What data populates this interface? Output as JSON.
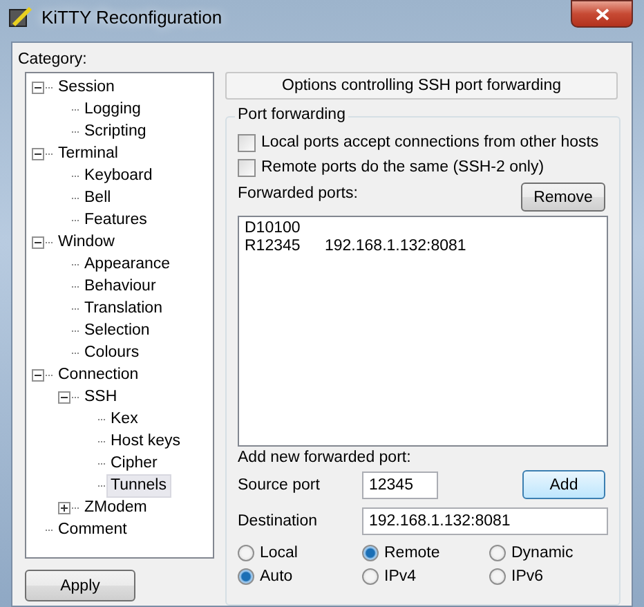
{
  "window": {
    "title": "KiTTY Reconfiguration"
  },
  "category_label": "Category:",
  "tree": {
    "items": [
      {
        "label": "Session",
        "expanded": true,
        "selected": false,
        "children": [
          {
            "label": "Logging",
            "selected": false
          },
          {
            "label": "Scripting",
            "selected": false
          }
        ]
      },
      {
        "label": "Terminal",
        "expanded": true,
        "selected": false,
        "children": [
          {
            "label": "Keyboard",
            "selected": false
          },
          {
            "label": "Bell",
            "selected": false
          },
          {
            "label": "Features",
            "selected": false
          }
        ]
      },
      {
        "label": "Window",
        "expanded": true,
        "selected": false,
        "children": [
          {
            "label": "Appearance",
            "selected": false
          },
          {
            "label": "Behaviour",
            "selected": false
          },
          {
            "label": "Translation",
            "selected": false
          },
          {
            "label": "Selection",
            "selected": false
          },
          {
            "label": "Colours",
            "selected": false
          }
        ]
      },
      {
        "label": "Connection",
        "expanded": true,
        "selected": false,
        "children": [
          {
            "label": "SSH",
            "expanded": true,
            "selected": false,
            "children": [
              {
                "label": "Kex",
                "selected": false
              },
              {
                "label": "Host keys",
                "selected": false
              },
              {
                "label": "Cipher",
                "selected": false
              },
              {
                "label": "Tunnels",
                "selected": true
              }
            ]
          },
          {
            "label": "ZModem",
            "expanded": false,
            "selected": false
          }
        ]
      },
      {
        "label": "Comment",
        "selected": false
      }
    ]
  },
  "apply_button": "Apply",
  "panel_title": "Options controlling SSH port forwarding",
  "port_forwarding": {
    "title": "Port forwarding",
    "checkboxes": [
      {
        "label": "Local ports accept connections from other hosts",
        "checked": false
      },
      {
        "label": "Remote ports do the same (SSH-2 only)",
        "checked": false
      }
    ],
    "forwarded_ports_label": "Forwarded ports:",
    "remove_button": "Remove",
    "forwarded_ports": [
      {
        "port": "D10100"
      },
      {
        "port": "R12345",
        "destination": "192.168.1.132:8081"
      }
    ]
  },
  "add_new": {
    "label": "Add new forwarded port:",
    "source_port": {
      "label": "Source port",
      "value": "12345"
    },
    "add_button": "Add",
    "destination": {
      "label": "Destination",
      "value": "192.168.1.132:8081"
    },
    "radio_rows": [
      {
        "options": [
          {
            "label": "Local",
            "selected": false
          },
          {
            "label": "Remote",
            "selected": true
          },
          {
            "label": "Dynamic",
            "selected": false
          }
        ]
      },
      {
        "options": [
          {
            "label": "Auto",
            "selected": true
          },
          {
            "label": "IPv4",
            "selected": false
          },
          {
            "label": "IPv6",
            "selected": false
          }
        ]
      }
    ]
  }
}
